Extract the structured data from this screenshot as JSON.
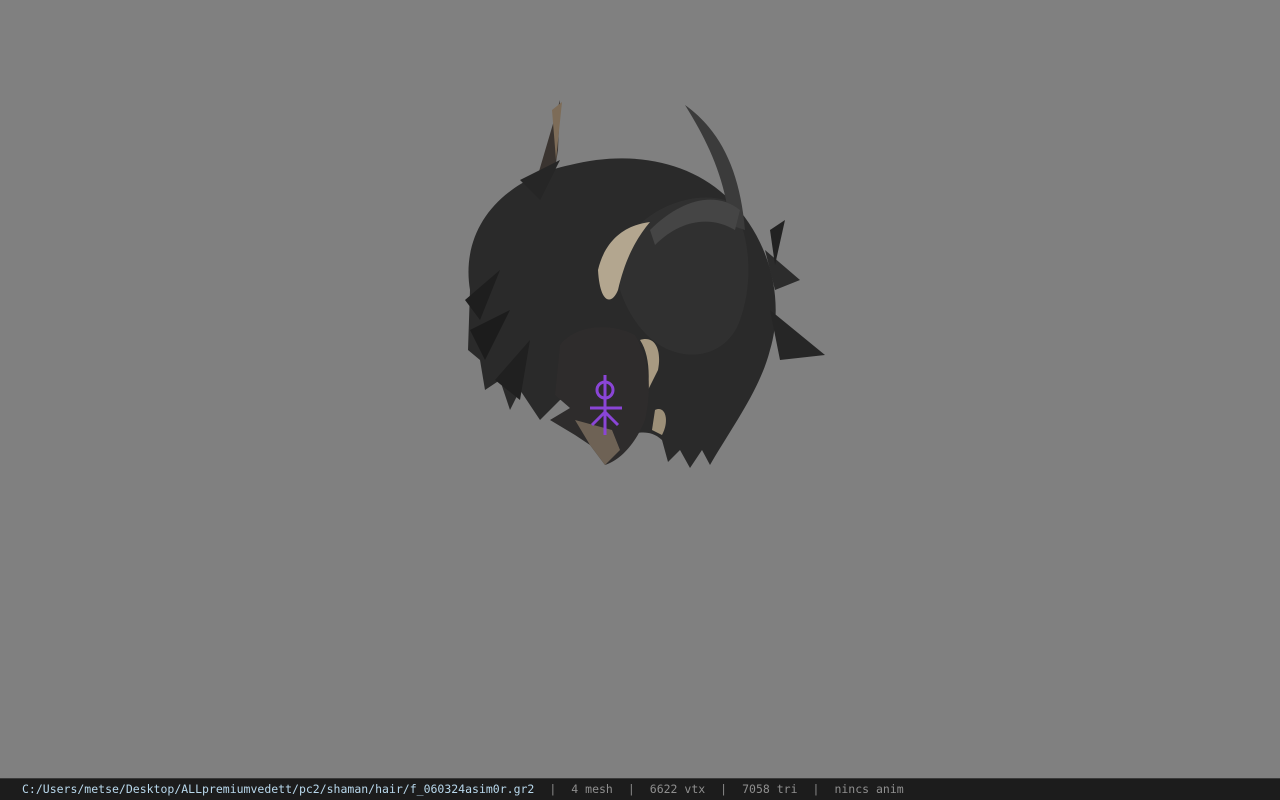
{
  "viewport": {
    "background_color": "#808080",
    "model_icon": "hair-mesh-model"
  },
  "statusbar": {
    "path": "C:/Users/metse/Desktop/ALLpremiumvedett/pc2/shaman/hair/f_060324asim0r.gr2",
    "separator": "|",
    "mesh": "4 mesh",
    "vtx": "6622 vtx",
    "tri": "7058 tri",
    "anim": "nincs anim",
    "path_color": "#b8d8ec",
    "text_color": "#8f8f8f"
  }
}
